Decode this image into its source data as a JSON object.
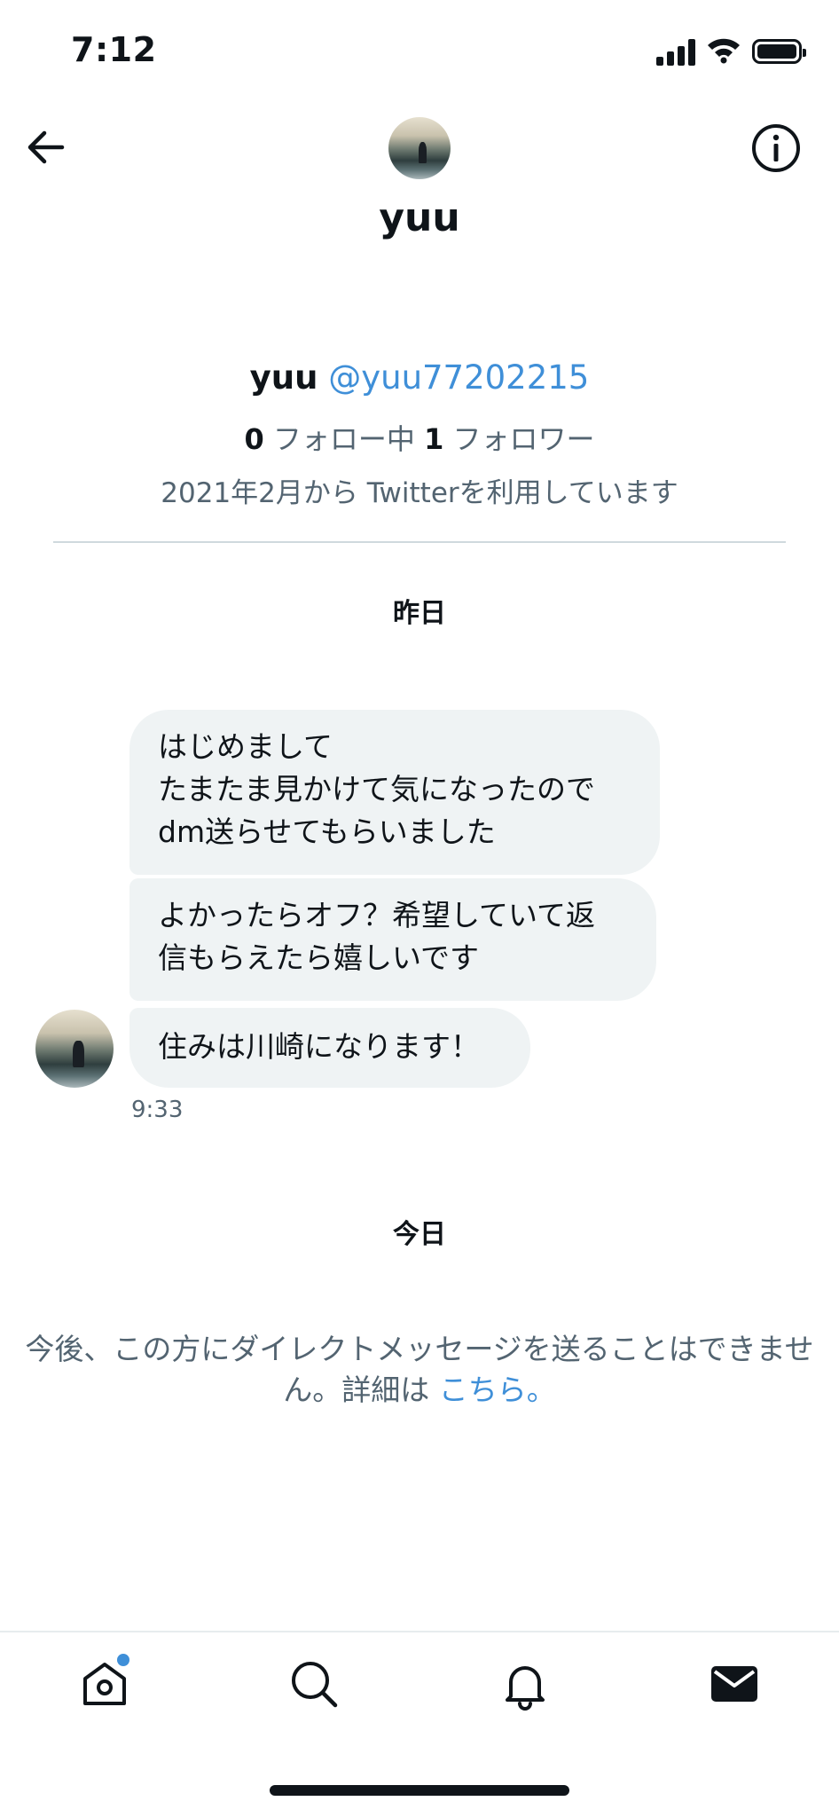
{
  "status_bar": {
    "time": "7:12"
  },
  "header": {
    "name": "yuu"
  },
  "profile": {
    "name": "yuu",
    "handle": "@yuu77202215",
    "following_count": "0",
    "following_label": "フォロー中",
    "followers_count": "1",
    "followers_label": "フォロワー",
    "joined": "2021年2月から Twitterを利用しています"
  },
  "conversation": {
    "day_yesterday": "昨日",
    "messages": [
      {
        "text": "はじめまして\nたまたま見かけて気になったので\ndm送らせてもらいました"
      },
      {
        "text": "よかったらオフ？希望していて返\n信もらえたら嬉しいです"
      },
      {
        "text": "住みは川崎になります！"
      }
    ],
    "time": "9:33",
    "day_today": "今日"
  },
  "notice": {
    "text": "今後、この方にダイレクトメッセージを送ることはできません。詳細は",
    "link": "こちら。"
  },
  "tabbar": {
    "tabs": [
      {
        "icon": "home-icon",
        "has_notification": true
      },
      {
        "icon": "search-icon"
      },
      {
        "icon": "bell-icon"
      },
      {
        "icon": "mail-icon",
        "active": true
      }
    ]
  },
  "colors": {
    "accent": "#3f8fd8",
    "bubble": "#eff3f4",
    "secondary_text": "#536471"
  }
}
